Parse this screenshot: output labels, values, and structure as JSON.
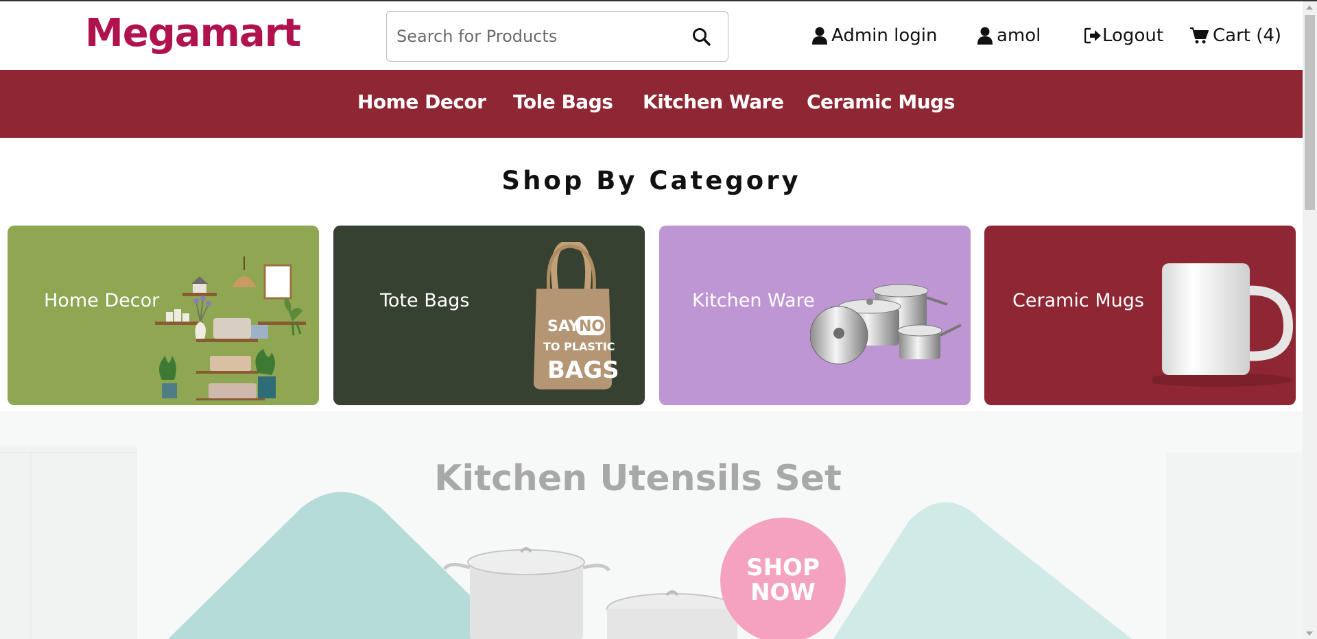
{
  "header": {
    "logo": "Megamart",
    "search_placeholder": "Search for Products",
    "admin_login": "Admin login",
    "user": "amol",
    "logout": "Logout",
    "cart": "Cart (4)"
  },
  "nav": {
    "items": [
      {
        "label": "Home Decor"
      },
      {
        "label": "Tole Bags"
      },
      {
        "label": "Kitchen Ware"
      },
      {
        "label": "Ceramic Mugs"
      }
    ]
  },
  "section": {
    "title": "Shop By Category"
  },
  "categories": [
    {
      "label": "Home Decor",
      "color": "#8fa653"
    },
    {
      "label": "Tote Bags",
      "color": "#374131"
    },
    {
      "label": "Kitchen Ware",
      "color": "#bf96d4"
    },
    {
      "label": "Ceramic Mugs",
      "color": "#8f2634"
    }
  ],
  "bag_text": {
    "line1": "SAY",
    "line1b": "NO",
    "line2": "TO PLASTIC",
    "line3": "BAGS"
  },
  "banner": {
    "title": "Kitchen Utensils Set",
    "shop_now_line1": "SHOP",
    "shop_now_line2": "NOW"
  },
  "colors": {
    "brand": "#b0124f",
    "nav_bg": "#8f2634",
    "shop_now": "#f4a2bf"
  },
  "icons": [
    "search-icon",
    "user-icon",
    "logout-icon",
    "cart-icon"
  ]
}
